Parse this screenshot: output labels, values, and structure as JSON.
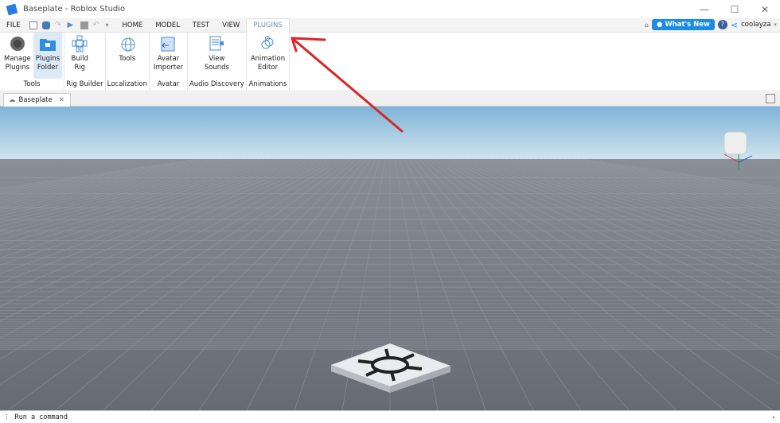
{
  "window": {
    "title": "Baseplate - Roblox Studio",
    "min": "—",
    "max": "☐",
    "close": "✕"
  },
  "menu": {
    "items": [
      "FILE",
      "HOME",
      "MODEL",
      "TEST",
      "VIEW",
      "PLUGINS"
    ],
    "active": "PLUGINS",
    "whats_new": "What's New",
    "user": "coolayza"
  },
  "ribbon": {
    "groups": [
      {
        "label": "Tools",
        "buttons": [
          {
            "label1": "Manage",
            "label2": "Plugins",
            "icon": "plug-gear-icon"
          },
          {
            "label1": "Plugins",
            "label2": "Folder",
            "icon": "plugin-folder-icon"
          }
        ]
      },
      {
        "label": "Rig Builder",
        "buttons": [
          {
            "label1": "Build",
            "label2": "Rig",
            "icon": "rig-icon"
          }
        ]
      },
      {
        "label": "Localization",
        "buttons": [
          {
            "label1": "Tools",
            "label2": "",
            "icon": "globe-icon"
          }
        ]
      },
      {
        "label": "Avatar",
        "buttons": [
          {
            "label1": "Avatar",
            "label2": "Importer",
            "icon": "avatar-importer-icon"
          }
        ]
      },
      {
        "label": "Audio Discovery",
        "buttons": [
          {
            "label1": "View",
            "label2": "Sounds",
            "icon": "document-sound-icon"
          }
        ]
      },
      {
        "label": "Animations",
        "buttons": [
          {
            "label1": "Animation",
            "label2": "Editor",
            "icon": "animation-icon"
          }
        ]
      }
    ]
  },
  "tabs": {
    "doc": "Baseplate",
    "close": "✕"
  },
  "command": {
    "placeholder": "Run a command"
  },
  "colors": {
    "accent": "#1a8be6",
    "annotation_arrow": "#d9262b",
    "sky_top": "#7fb4d8",
    "ground": "#6f737b"
  }
}
